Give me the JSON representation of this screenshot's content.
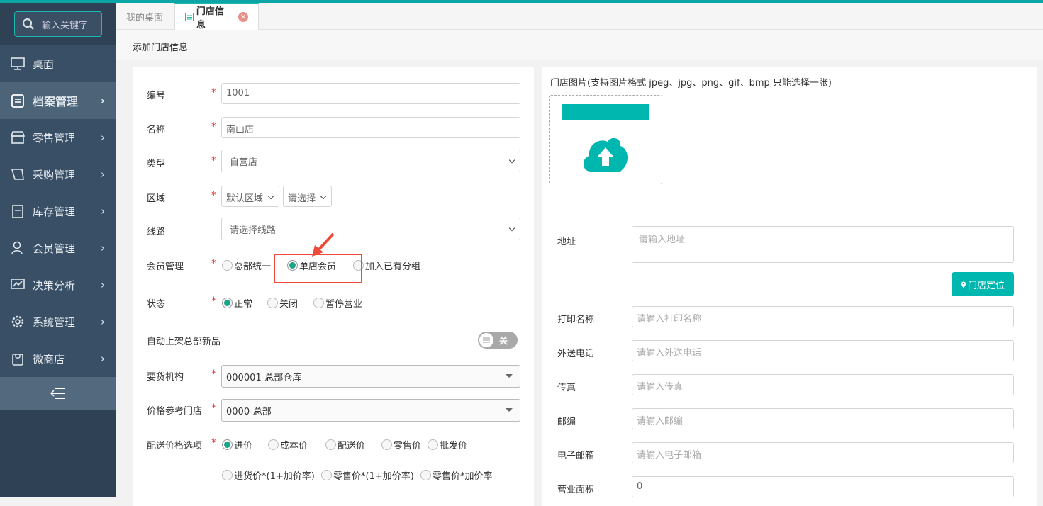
{
  "search": {
    "placeholder": "输入关键字"
  },
  "sidebar": {
    "items": [
      {
        "label": "桌面",
        "icon": "monitor-icon"
      },
      {
        "label": "档案管理",
        "icon": "archive-icon"
      },
      {
        "label": "零售管理",
        "icon": "store-icon"
      },
      {
        "label": "采购管理",
        "icon": "purchase-icon"
      },
      {
        "label": "库存管理",
        "icon": "inventory-icon"
      },
      {
        "label": "会员管理",
        "icon": "user-icon"
      },
      {
        "label": "决策分析",
        "icon": "chart-icon"
      },
      {
        "label": "系统管理",
        "icon": "gear-icon"
      },
      {
        "label": "微商店",
        "icon": "bag-icon"
      }
    ]
  },
  "tabs": [
    {
      "label": "我的桌面"
    },
    {
      "label": "门店信息"
    }
  ],
  "page_title": "添加门店信息",
  "form": {
    "code": {
      "label": "编号",
      "value": "1001"
    },
    "name": {
      "label": "名称",
      "value": "南山店"
    },
    "type": {
      "label": "类型",
      "value": "自营店"
    },
    "region": {
      "label": "区域",
      "value": "默认区域",
      "value2": "请选择"
    },
    "route": {
      "label": "线路",
      "value": "请选择线路"
    },
    "member": {
      "label": "会员管理",
      "options": [
        "总部统一",
        "单店会员",
        "加入已有分组"
      ],
      "selected": "单店会员"
    },
    "status": {
      "label": "状态",
      "options": [
        "正常",
        "关闭",
        "暂停营业"
      ],
      "selected": "正常"
    },
    "auto_shelf": {
      "label": "自动上架总部新品",
      "toggle": "关"
    },
    "supplier": {
      "label": "要货机构",
      "value": "000001-总部仓库"
    },
    "price_ref": {
      "label": "价格参考门店",
      "value": "0000-总部"
    },
    "delivery_price": {
      "label": "配送价格选项",
      "options": [
        "进价",
        "成本价",
        "配送价",
        "零售价",
        "批发价",
        "进货价*(1+加价率)",
        "零售价*(1+加价率)",
        "零售价*加价率"
      ],
      "selected": "进价"
    }
  },
  "right": {
    "image_label": "门店图片(支持图片格式 jpeg、jpg、png、gif、bmp 只能选择一张)",
    "address": {
      "label": "地址",
      "placeholder": "请输入地址"
    },
    "locate_button": "门店定位",
    "print_name": {
      "label": "打印名称",
      "placeholder": "请输入打印名称"
    },
    "delivery_phone": {
      "label": "外送电话",
      "placeholder": "请输入外送电话"
    },
    "fax": {
      "label": "传真",
      "placeholder": "请输入传真"
    },
    "zip": {
      "label": "邮编",
      "placeholder": "请输入邮编"
    },
    "email": {
      "label": "电子邮箱",
      "placeholder": "请输入电子邮箱"
    },
    "area": {
      "label": "营业面积",
      "value": "0"
    }
  },
  "colors": {
    "accent": "#00b7b0",
    "sidebar": "#394f66",
    "highlight": "#f04a3a"
  }
}
